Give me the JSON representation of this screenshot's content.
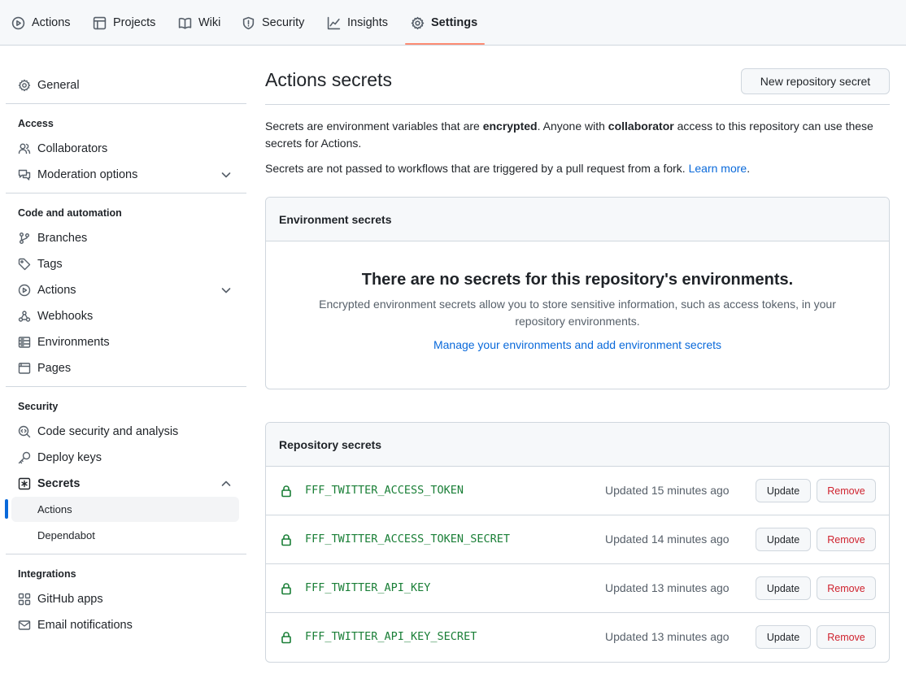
{
  "colors": {
    "accent_link": "#0969da",
    "secret_name": "#1a7f37",
    "danger": "#cf222e",
    "tab_underline": "#fd8c73"
  },
  "topnav": {
    "tabs": [
      {
        "label": "Actions",
        "icon": "play-circle-icon"
      },
      {
        "label": "Projects",
        "icon": "table-icon"
      },
      {
        "label": "Wiki",
        "icon": "book-icon"
      },
      {
        "label": "Security",
        "icon": "shield-icon"
      },
      {
        "label": "Insights",
        "icon": "graph-icon"
      },
      {
        "label": "Settings",
        "icon": "gear-icon",
        "selected": true
      }
    ]
  },
  "sidebar": {
    "general": "General",
    "access_heading": "Access",
    "collaborators": "Collaborators",
    "moderation": "Moderation options",
    "code_heading": "Code and automation",
    "branches": "Branches",
    "tags": "Tags",
    "actions": "Actions",
    "webhooks": "Webhooks",
    "environments": "Environments",
    "pages": "Pages",
    "security_heading": "Security",
    "code_security": "Code security and analysis",
    "deploy_keys": "Deploy keys",
    "secrets": "Secrets",
    "secrets_sub": [
      "Actions",
      "Dependabot"
    ],
    "integrations_heading": "Integrations",
    "github_apps": "GitHub apps",
    "email_notifications": "Email notifications"
  },
  "main": {
    "title": "Actions secrets",
    "new_button": "New repository secret",
    "intro": {
      "p1_a": "Secrets are environment variables that are ",
      "p1_b": "encrypted",
      "p1_c": ". Anyone with ",
      "p1_d": "collaborator",
      "p1_e": " access to this repository can use these secrets for Actions.",
      "p2_a": "Secrets are not passed to workflows that are triggered by a pull request from a fork. ",
      "p2_link": "Learn more",
      "p2_end": "."
    },
    "env_box": {
      "heading": "Environment secrets",
      "blank_title": "There are no secrets for this repository's environments.",
      "blank_desc": "Encrypted environment secrets allow you to store sensitive information, such as access tokens, in your repository environments.",
      "manage_link": "Manage your environments and add environment secrets"
    },
    "repo_box": {
      "heading": "Repository secrets",
      "update_label": "Update",
      "remove_label": "Remove",
      "secrets": [
        {
          "name": "FFF_TWITTER_ACCESS_TOKEN",
          "updated": "Updated 15 minutes ago"
        },
        {
          "name": "FFF_TWITTER_ACCESS_TOKEN_SECRET",
          "updated": "Updated 14 minutes ago"
        },
        {
          "name": "FFF_TWITTER_API_KEY",
          "updated": "Updated 13 minutes ago"
        },
        {
          "name": "FFF_TWITTER_API_KEY_SECRET",
          "updated": "Updated 13 minutes ago"
        }
      ]
    }
  }
}
